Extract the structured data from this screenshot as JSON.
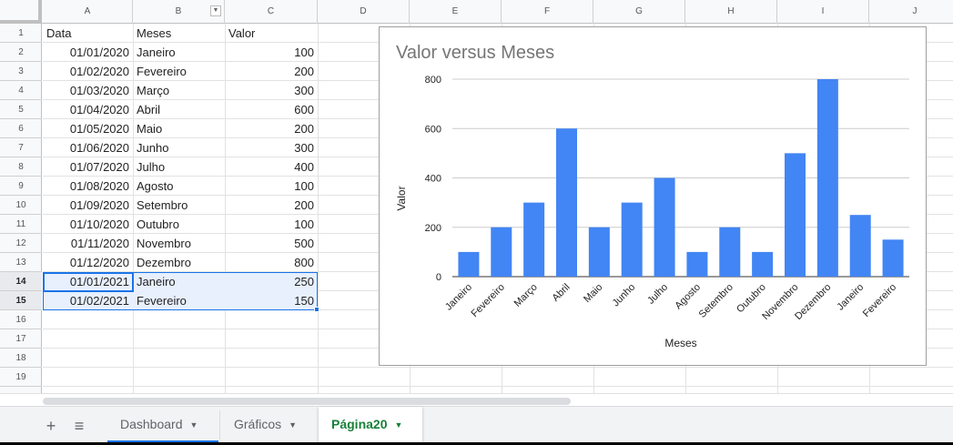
{
  "columns": [
    "A",
    "B",
    "C",
    "D",
    "E",
    "F",
    "G",
    "H",
    "I",
    "J"
  ],
  "rows": [
    "1",
    "2",
    "3",
    "4",
    "5",
    "6",
    "7",
    "8",
    "9",
    "10",
    "11",
    "12",
    "13",
    "14",
    "15",
    "16",
    "17",
    "18",
    "19"
  ],
  "table": {
    "header": [
      "Data",
      "Meses",
      "Valor"
    ],
    "records": [
      [
        "01/01/2020",
        "Janeiro",
        "100"
      ],
      [
        "01/02/2020",
        "Fevereiro",
        "200"
      ],
      [
        "01/03/2020",
        "Março",
        "300"
      ],
      [
        "01/04/2020",
        "Abril",
        "600"
      ],
      [
        "01/05/2020",
        "Maio",
        "200"
      ],
      [
        "01/06/2020",
        "Junho",
        "300"
      ],
      [
        "01/07/2020",
        "Julho",
        "400"
      ],
      [
        "01/08/2020",
        "Agosto",
        "100"
      ],
      [
        "01/09/2020",
        "Setembro",
        "200"
      ],
      [
        "01/10/2020",
        "Outubro",
        "100"
      ],
      [
        "01/11/2020",
        "Novembro",
        "500"
      ],
      [
        "01/12/2020",
        "Dezembro",
        "800"
      ],
      [
        "01/01/2021",
        "Janeiro",
        "250"
      ],
      [
        "01/02/2021",
        "Fevereiro",
        "150"
      ]
    ]
  },
  "chart_data": {
    "type": "bar",
    "title": "Valor versus Meses",
    "xlabel": "Meses",
    "ylabel": "Valor",
    "categories": [
      "Janeiro",
      "Fevereiro",
      "Março",
      "Abril",
      "Maio",
      "Junho",
      "Julho",
      "Agosto",
      "Setembro",
      "Outubro",
      "Novembro",
      "Dezembro",
      "Janeiro",
      "Fevereiro"
    ],
    "values": [
      100,
      200,
      300,
      600,
      200,
      300,
      400,
      100,
      200,
      100,
      500,
      800,
      250,
      150
    ],
    "ylim": [
      0,
      800
    ],
    "yticks": [
      0,
      200,
      400,
      600,
      800
    ],
    "grid": true,
    "bar_color": "#4285f4"
  },
  "tabs": {
    "add_icon": "plus-icon",
    "list_icon": "menu-icon",
    "items": [
      {
        "label": "Dashboard"
      },
      {
        "label": "Gráficos"
      },
      {
        "label": "Página20"
      }
    ]
  },
  "colors": {
    "selection": "#1a73e8",
    "active_tab_text": "#188038"
  }
}
